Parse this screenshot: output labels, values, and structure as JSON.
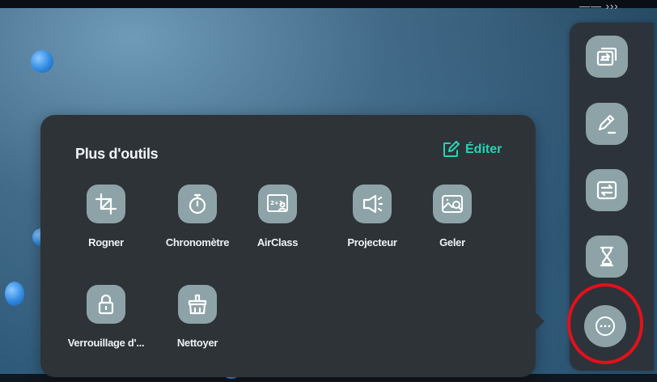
{
  "panel": {
    "title": "Plus d'outils",
    "edit_label": "Éditer",
    "tools": [
      {
        "label": "Rogner",
        "icon": "crop-icon"
      },
      {
        "label": "Chronomètre",
        "icon": "stopwatch-icon"
      },
      {
        "label": "AirClass",
        "icon": "airclass-icon"
      },
      {
        "label": "Projecteur",
        "icon": "spotlight-icon"
      },
      {
        "label": "Geler",
        "icon": "freeze-icon"
      },
      {
        "label": "Verrouillage d'...",
        "icon": "lock-icon"
      },
      {
        "label": "Nettoyer",
        "icon": "broom-icon"
      }
    ]
  },
  "toolbar": {
    "top_hint": "—— ›››",
    "buttons": [
      {
        "icon": "switch-window-icon"
      },
      {
        "icon": "pen-icon"
      },
      {
        "icon": "screen-share-icon"
      },
      {
        "icon": "hourglass-icon"
      },
      {
        "icon": "more-icon"
      }
    ]
  },
  "colors": {
    "accent": "#27d3b4",
    "icon_bg": "#8da3a8",
    "panel_bg": "#2e3338",
    "highlight_ring": "#e4101a"
  }
}
